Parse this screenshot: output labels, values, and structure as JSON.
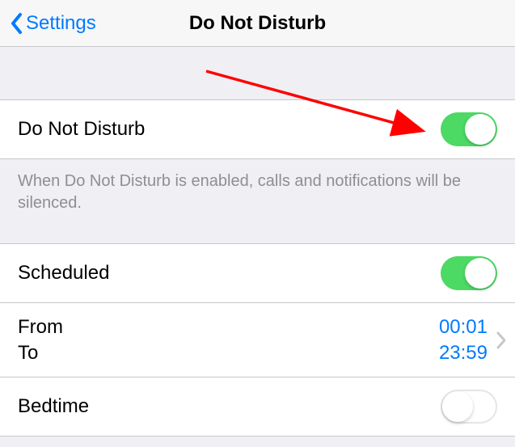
{
  "nav": {
    "back_label": "Settings",
    "title": "Do Not Disturb"
  },
  "dnd": {
    "label": "Do Not Disturb",
    "enabled": true,
    "footer": "When Do Not Disturb is enabled, calls and notifications will be silenced."
  },
  "scheduled": {
    "label": "Scheduled",
    "enabled": true,
    "from_label": "From",
    "to_label": "To",
    "from_value": "00:01",
    "to_value": "23:59"
  },
  "bedtime": {
    "label": "Bedtime",
    "enabled": false
  },
  "colors": {
    "link": "#007aff",
    "toggle_on": "#4cd964",
    "arrow": "#ff0000"
  }
}
